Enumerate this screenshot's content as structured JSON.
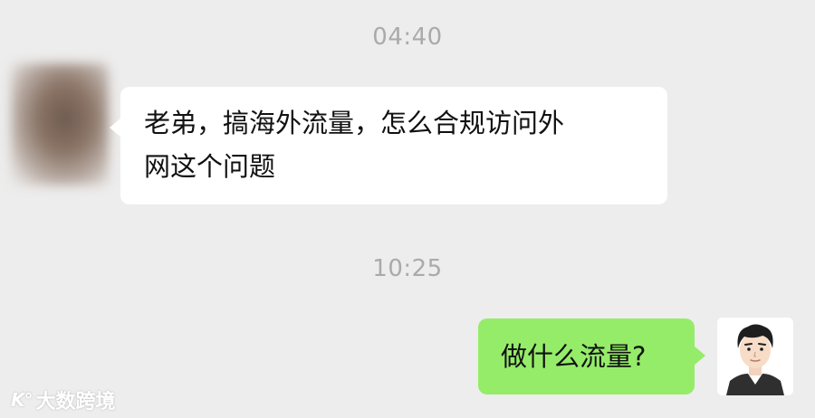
{
  "chat": {
    "messages": [
      {
        "time": "04:40",
        "sender": "contact",
        "text_line1": "老弟，搞海外流量，怎么合规访问外",
        "text_line2": "网这个问题"
      },
      {
        "time": "10:25",
        "sender": "self",
        "text": "做什么流量?"
      }
    ]
  },
  "watermark": {
    "logo": "K°",
    "text": "大数跨境"
  },
  "colors": {
    "background": "#ededed",
    "incoming_bubble": "#ffffff",
    "outgoing_bubble": "#95ec69",
    "timestamp": "#aaaaaa"
  }
}
